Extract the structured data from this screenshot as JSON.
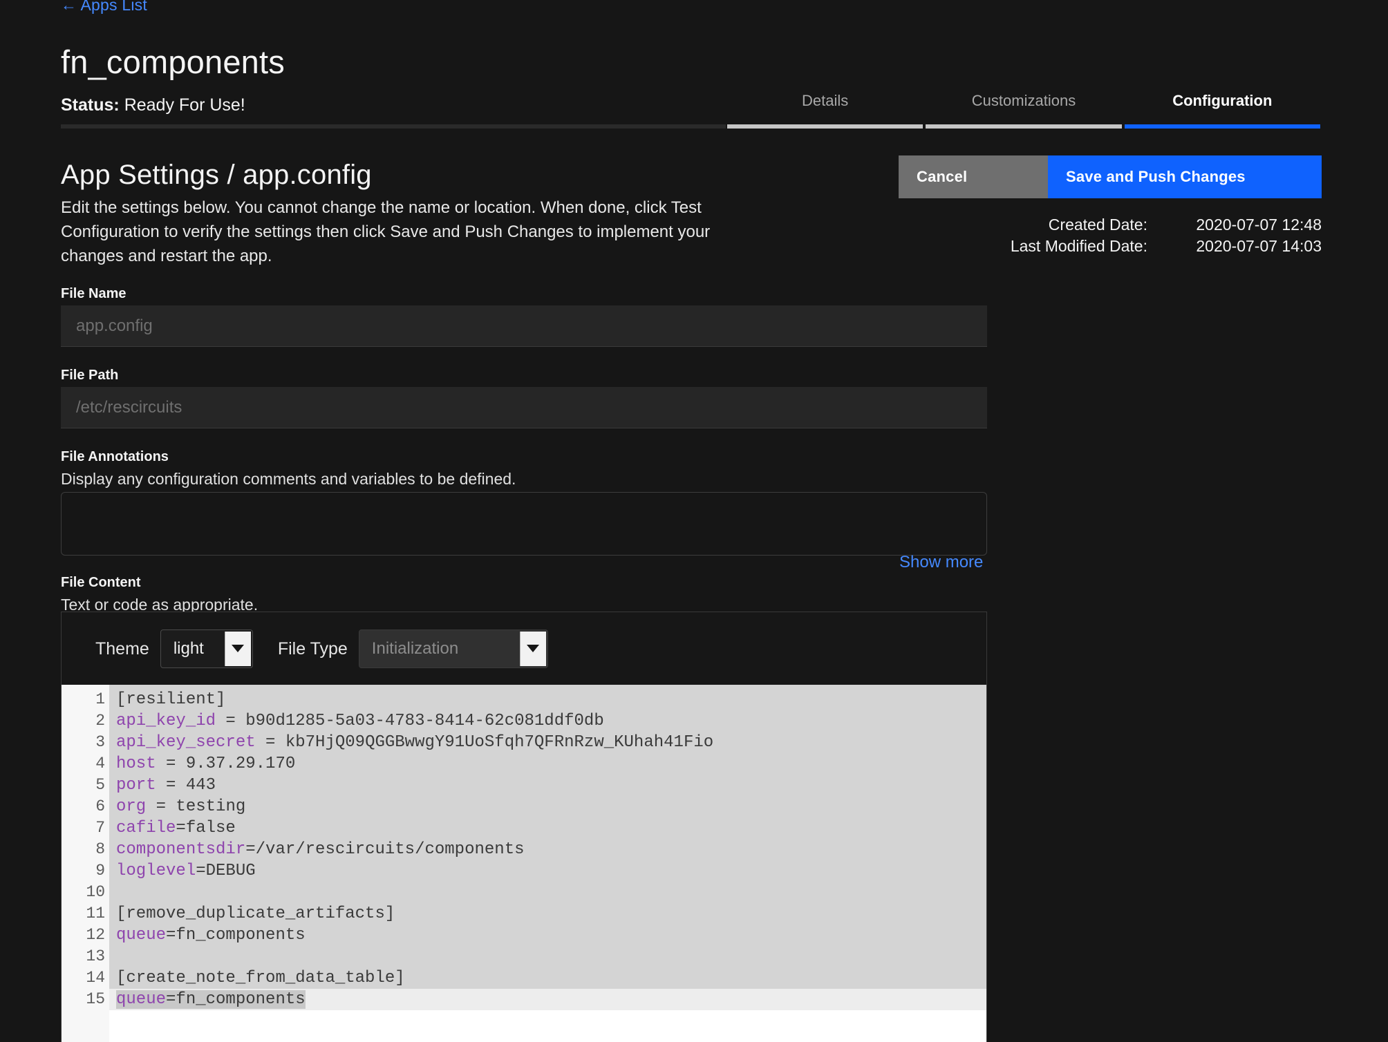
{
  "header": {
    "back_link": "← Apps List",
    "app_name": "fn_components",
    "status_label": "Status:",
    "status_value": "Ready For Use!"
  },
  "tabs": [
    {
      "label": "Details",
      "active": false
    },
    {
      "label": "Customizations",
      "active": false
    },
    {
      "label": "Configuration",
      "active": true
    }
  ],
  "main": {
    "title": "App Settings / app.config",
    "description": "Edit the settings below. You cannot change the name or location. When done, click Test Configuration to verify the settings then click Save and Push Changes to implement your changes and restart the app.",
    "cancel_label": "Cancel",
    "save_label": "Save and Push Changes",
    "created_date_label": "Created Date:",
    "created_date_value": "2020-07-07 12:48",
    "last_modified_label": "Last Modified Date:",
    "last_modified_value": "2020-07-07 14:03"
  },
  "fields": {
    "file_name_label": "File Name",
    "file_name_placeholder": "app.config",
    "file_name_value": "",
    "file_path_label": "File Path",
    "file_path_placeholder": "/etc/rescircuits",
    "file_path_value": "",
    "annotations_label": "File Annotations",
    "annotations_helper": "Display any configuration comments and variables to be defined.",
    "annotations_value": "",
    "show_more_label": "Show more",
    "content_label": "File Content",
    "content_helper": "Text or code as appropriate."
  },
  "editor": {
    "theme_label": "Theme",
    "theme_value": "light",
    "file_type_label": "File Type",
    "file_type_value": "Initialization",
    "lines": [
      {
        "n": "1",
        "fold": true,
        "key": "",
        "rest": "[resilient]",
        "active": false
      },
      {
        "n": "2",
        "fold": false,
        "key": "api_key_id",
        "rest": " = b90d1285-5a03-4783-8414-62c081ddf0db",
        "active": false
      },
      {
        "n": "3",
        "fold": false,
        "key": "api_key_secret",
        "rest": " = kb7HjQ09QGGBwwgY91UoSfqh7QFRnRzw_KUhah41Fio",
        "active": false
      },
      {
        "n": "4",
        "fold": false,
        "key": "host",
        "rest": " = 9.37.29.170",
        "active": false
      },
      {
        "n": "5",
        "fold": false,
        "key": "port",
        "rest": " = 443",
        "active": false
      },
      {
        "n": "6",
        "fold": false,
        "key": "org",
        "rest": " = testing",
        "active": false
      },
      {
        "n": "7",
        "fold": false,
        "key": "cafile",
        "rest": "=false",
        "active": false
      },
      {
        "n": "8",
        "fold": false,
        "key": "componentsdir",
        "rest": "=/var/rescircuits/components",
        "active": false
      },
      {
        "n": "9",
        "fold": false,
        "key": "loglevel",
        "rest": "=DEBUG",
        "active": false
      },
      {
        "n": "10",
        "fold": false,
        "key": "",
        "rest": "",
        "active": false
      },
      {
        "n": "11",
        "fold": true,
        "key": "",
        "rest": "[remove_duplicate_artifacts]",
        "active": false
      },
      {
        "n": "12",
        "fold": false,
        "key": "queue",
        "rest": "=fn_components",
        "active": false
      },
      {
        "n": "13",
        "fold": false,
        "key": "",
        "rest": "",
        "active": false
      },
      {
        "n": "14",
        "fold": true,
        "key": "",
        "rest": "[create_note_from_data_table]",
        "active": false
      },
      {
        "n": "15",
        "fold": false,
        "key": "queue",
        "rest": "=fn_components",
        "active": true
      }
    ]
  },
  "colors": {
    "background": "#161616",
    "accent_blue": "#0f62fe",
    "link_blue": "#4589ff",
    "cancel_gray": "#6f6f6f",
    "code_keyword": "#8e44ad",
    "code_background": "#d4d4d4"
  }
}
